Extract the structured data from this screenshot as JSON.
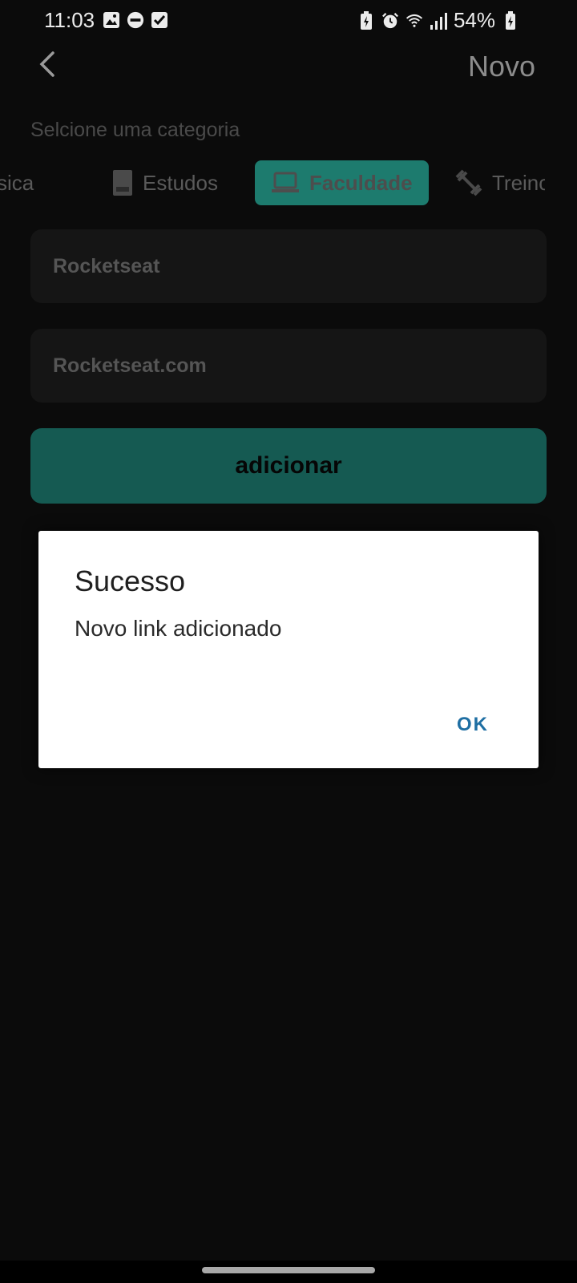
{
  "status_bar": {
    "time": "11:03",
    "battery": "54%",
    "left_icons": [
      "image-icon",
      "do-not-disturb-icon",
      "checkbox-icon"
    ],
    "right_icons": [
      "battery-saver-icon",
      "alarm-icon",
      "wifi-icon",
      "signal-icon",
      "battery-icon"
    ]
  },
  "header": {
    "title": "Novo",
    "back_icon": "chevron-left-icon"
  },
  "category_label": "Selcione uma categoria",
  "categories": [
    {
      "label": "sica",
      "icon": "",
      "active": false
    },
    {
      "label": "Estudos",
      "icon": "book-icon",
      "active": false
    },
    {
      "label": "Faculdade",
      "icon": "laptop-icon",
      "active": true
    },
    {
      "label": "Treinc",
      "icon": "dumbbell-icon",
      "active": false
    }
  ],
  "form": {
    "name_value": "Rocketseat",
    "url_value": "Rocketseat.com",
    "submit_label": "adicionar"
  },
  "dialog": {
    "title": "Sucesso",
    "message": "Novo link adicionado",
    "ok_label": "OK"
  },
  "colors": {
    "accent": "#1d7b6e",
    "button": "#155a52",
    "background": "#0b0b0b",
    "dialog_action": "#1f6fa3"
  }
}
